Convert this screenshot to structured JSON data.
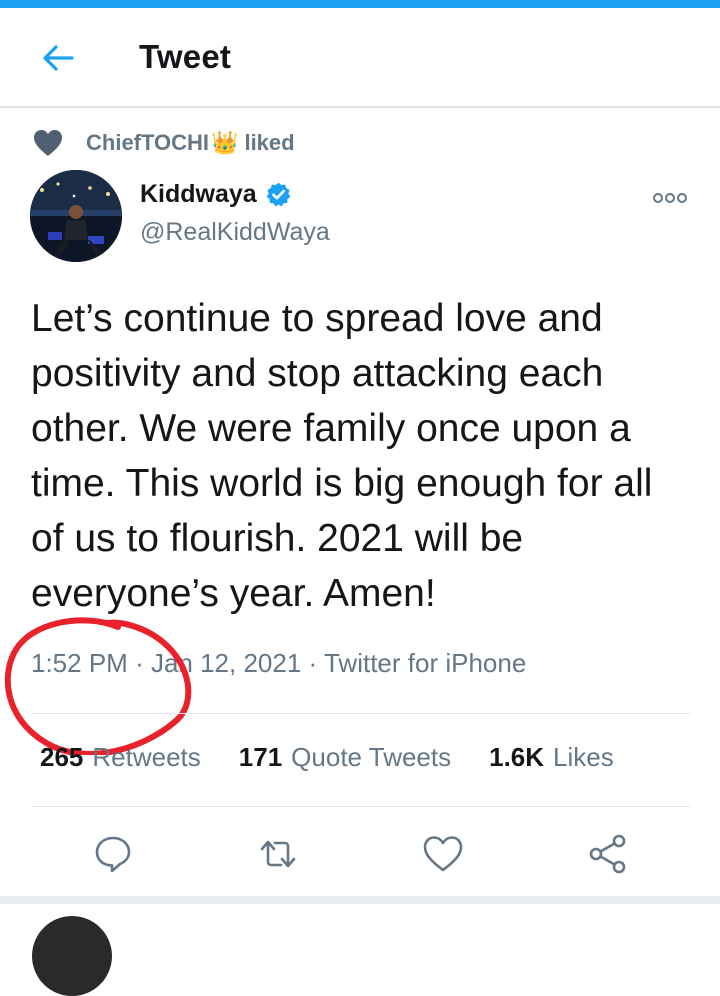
{
  "header": {
    "title": "Tweet"
  },
  "social_context": {
    "liker": "ChiefTOCHI",
    "liker_emoji": "👑",
    "action": "liked"
  },
  "author": {
    "name": "Kiddwaya",
    "handle": "@RealKiddWaya",
    "verified": true
  },
  "tweet": {
    "text": "Let’s continue to spread love and positivity and stop attacking each other. We were family once upon a time. This world is big enough for all of us to flourish. 2021 will be everyone’s year. Amen!",
    "time": "1:52 PM",
    "date": "Jan 12, 2021",
    "source": "Twitter for iPhone"
  },
  "stats": {
    "retweets": {
      "count": "265",
      "label": "Retweets"
    },
    "quotes": {
      "count": "171",
      "label": "Quote Tweets"
    },
    "likes": {
      "count": "1.6K",
      "label": "Likes"
    }
  },
  "actions": [
    "reply-icon",
    "retweet-icon",
    "like-icon",
    "share-icon"
  ],
  "colors": {
    "accent": "#1da1f2",
    "muted": "#657786",
    "annotation": "#e8212b"
  }
}
